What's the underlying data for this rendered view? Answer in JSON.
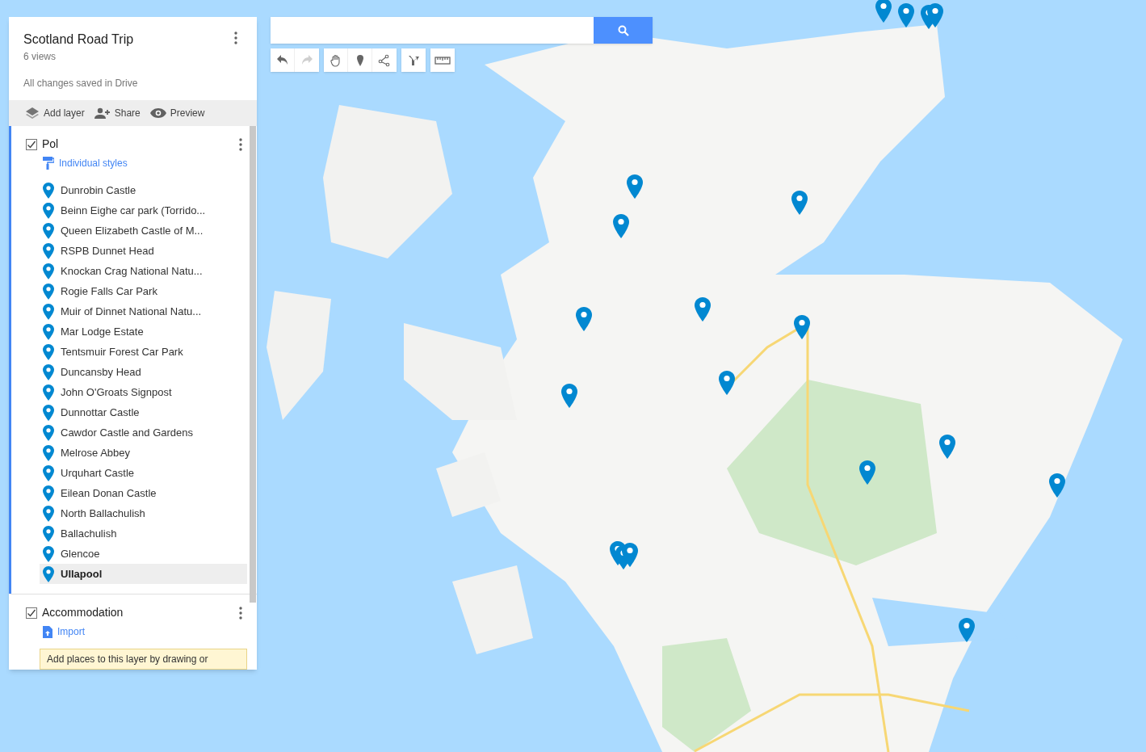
{
  "map": {
    "title": "Scotland Road Trip",
    "views": "6 views",
    "save_status": "All changes saved in Drive"
  },
  "actions": [
    {
      "kind": "layers",
      "label": "Add layer"
    },
    {
      "kind": "share",
      "label": "Share"
    },
    {
      "kind": "preview",
      "label": "Preview"
    }
  ],
  "layers": [
    {
      "name": "Pol",
      "checked": true,
      "active": true,
      "link": {
        "kind": "style",
        "label": "Individual styles"
      },
      "items": [
        {
          "label": "Dunrobin Castle",
          "selected": false
        },
        {
          "label": "Beinn Eighe car park (Torrido...",
          "selected": false
        },
        {
          "label": "Queen Elizabeth Castle of M...",
          "selected": false
        },
        {
          "label": "RSPB Dunnet Head",
          "selected": false
        },
        {
          "label": "Knockan Crag National Natu...",
          "selected": false
        },
        {
          "label": "Rogie Falls Car Park",
          "selected": false
        },
        {
          "label": "Muir of Dinnet National Natu...",
          "selected": false
        },
        {
          "label": "Mar Lodge Estate",
          "selected": false
        },
        {
          "label": "Tentsmuir Forest Car Park",
          "selected": false
        },
        {
          "label": "Duncansby Head",
          "selected": false
        },
        {
          "label": "John O'Groats Signpost",
          "selected": false
        },
        {
          "label": "Dunnottar Castle",
          "selected": false
        },
        {
          "label": "Cawdor Castle and Gardens",
          "selected": false
        },
        {
          "label": "Melrose Abbey",
          "selected": false
        },
        {
          "label": "Urquhart Castle",
          "selected": false
        },
        {
          "label": "Eilean Donan Castle",
          "selected": false
        },
        {
          "label": "North Ballachulish",
          "selected": false
        },
        {
          "label": "Ballachulish",
          "selected": false
        },
        {
          "label": "Glencoe",
          "selected": false
        },
        {
          "label": "Ullapool",
          "selected": true
        }
      ]
    },
    {
      "name": "Accommodation",
      "checked": true,
      "active": false,
      "link": {
        "kind": "import",
        "label": "Import"
      },
      "hint": "Add places to this layer by drawing or"
    }
  ],
  "toolbar": [
    {
      "kind": "undo",
      "disabled": false
    },
    {
      "kind": "redo",
      "disabled": true
    },
    {
      "kind": "hand",
      "disabled": false
    },
    {
      "kind": "marker",
      "disabled": false
    },
    {
      "kind": "line",
      "disabled": false
    },
    {
      "kind": "directions",
      "disabled": false
    },
    {
      "kind": "ruler",
      "disabled": false
    }
  ]
}
